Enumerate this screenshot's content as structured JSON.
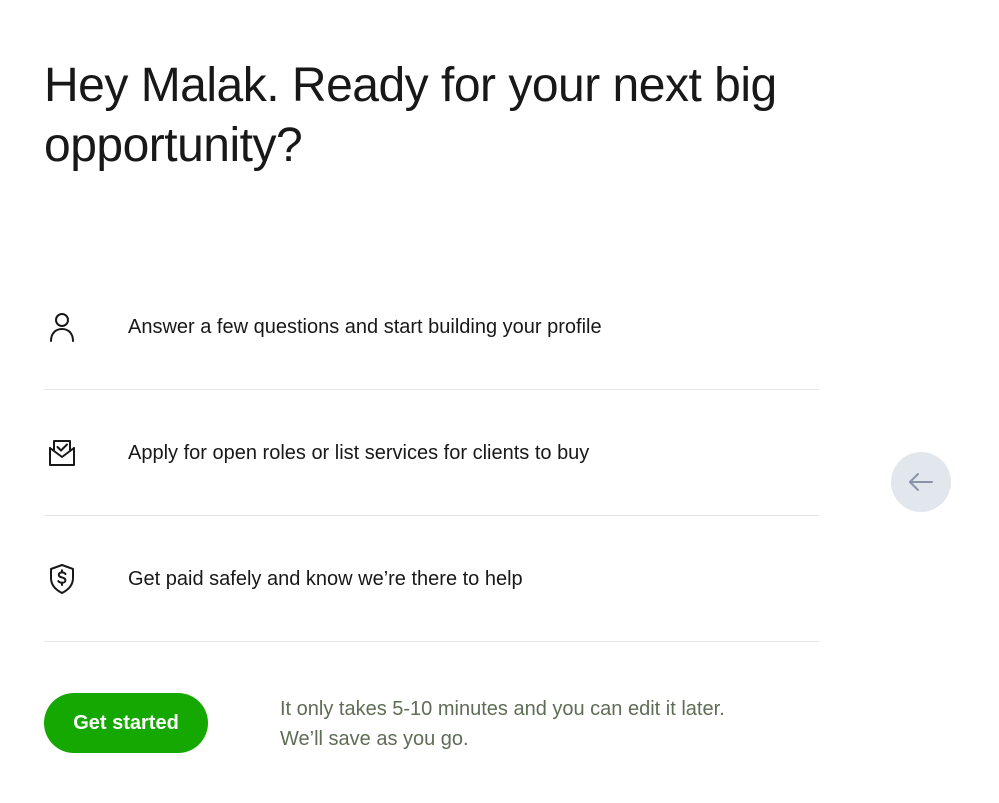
{
  "headline": "Hey Malak. Ready for your next big opportunity?",
  "steps": [
    {
      "icon": "person-icon",
      "text": "Answer a few questions and start building your profile"
    },
    {
      "icon": "envelope-check-icon",
      "text": "Apply for open roles or list services for clients to buy"
    },
    {
      "icon": "shield-dollar-icon",
      "text": "Get paid safely and know we’re there to help"
    }
  ],
  "cta": {
    "label": "Get started",
    "helper_line_1": "It only takes 5-10 minutes and you can edit it later.",
    "helper_line_2": "We’ll save as you go."
  },
  "back_button": {
    "icon": "arrow-left-icon"
  },
  "colors": {
    "primary_green": "#14a800",
    "text": "#181818",
    "muted_text": "#5e6d55",
    "divider": "#e4e5e7",
    "back_button_bg": "#e2e7ee"
  }
}
